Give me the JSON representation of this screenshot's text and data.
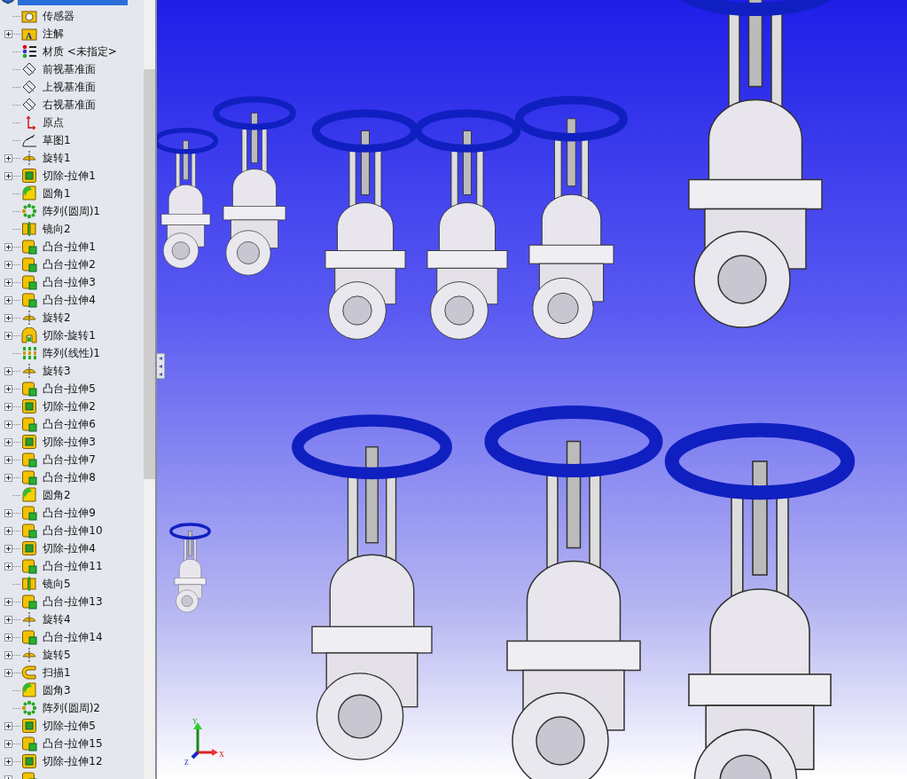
{
  "feature_tree": {
    "root": {
      "selected": true
    },
    "items": [
      {
        "label": "传感器",
        "kind": "sensor",
        "expandable": false
      },
      {
        "label": "注解",
        "kind": "annotation",
        "icon_text": "A",
        "expandable": true
      },
      {
        "label": "材质 <未指定>",
        "kind": "material",
        "expandable": false
      },
      {
        "label": "前视基准面",
        "kind": "plane",
        "expandable": false
      },
      {
        "label": "上视基准面",
        "kind": "plane",
        "expandable": false
      },
      {
        "label": "右视基准面",
        "kind": "plane",
        "expandable": false
      },
      {
        "label": "原点",
        "kind": "origin",
        "expandable": false
      },
      {
        "label": "草图1",
        "kind": "sketch",
        "expandable": false
      },
      {
        "label": "旋转1",
        "kind": "revolve",
        "expandable": true
      },
      {
        "label": "切除-拉伸1",
        "kind": "cut",
        "expandable": true
      },
      {
        "label": "圆角1",
        "kind": "fillet",
        "expandable": false
      },
      {
        "label": "阵列(圆周)1",
        "kind": "circular",
        "expandable": false
      },
      {
        "label": "镜向2",
        "kind": "mirror",
        "expandable": false
      },
      {
        "label": "凸台-拉伸1",
        "kind": "boss",
        "expandable": true
      },
      {
        "label": "凸台-拉伸2",
        "kind": "boss",
        "expandable": true
      },
      {
        "label": "凸台-拉伸3",
        "kind": "boss",
        "expandable": true
      },
      {
        "label": "凸台-拉伸4",
        "kind": "boss",
        "expandable": true
      },
      {
        "label": "旋转2",
        "kind": "revolve",
        "expandable": true
      },
      {
        "label": "切除-旋转1",
        "kind": "cutrevolve",
        "expandable": true
      },
      {
        "label": "阵列(线性)1",
        "kind": "linear",
        "expandable": false
      },
      {
        "label": "旋转3",
        "kind": "revolve",
        "expandable": true
      },
      {
        "label": "凸台-拉伸5",
        "kind": "boss",
        "expandable": true
      },
      {
        "label": "切除-拉伸2",
        "kind": "cut",
        "expandable": true
      },
      {
        "label": "凸台-拉伸6",
        "kind": "boss",
        "expandable": true
      },
      {
        "label": "切除-拉伸3",
        "kind": "cut",
        "expandable": true
      },
      {
        "label": "凸台-拉伸7",
        "kind": "boss",
        "expandable": true
      },
      {
        "label": "凸台-拉伸8",
        "kind": "boss",
        "expandable": true
      },
      {
        "label": "圆角2",
        "kind": "fillet",
        "expandable": false
      },
      {
        "label": "凸台-拉伸9",
        "kind": "boss",
        "expandable": true
      },
      {
        "label": "凸台-拉伸10",
        "kind": "boss",
        "expandable": true
      },
      {
        "label": "切除-拉伸4",
        "kind": "cut",
        "expandable": true
      },
      {
        "label": "凸台-拉伸11",
        "kind": "boss",
        "expandable": true
      },
      {
        "label": "镜向5",
        "kind": "mirror",
        "expandable": false
      },
      {
        "label": "凸台-拉伸13",
        "kind": "boss",
        "expandable": true
      },
      {
        "label": "旋转4",
        "kind": "revolve",
        "expandable": true
      },
      {
        "label": "凸台-拉伸14",
        "kind": "boss",
        "expandable": true
      },
      {
        "label": "旋转5",
        "kind": "revolve",
        "expandable": true
      },
      {
        "label": "扫描1",
        "kind": "sweep",
        "expandable": true
      },
      {
        "label": "圆角3",
        "kind": "fillet",
        "expandable": false
      },
      {
        "label": "阵列(圆周)2",
        "kind": "circular",
        "expandable": false
      },
      {
        "label": "切除-拉伸5",
        "kind": "cut",
        "expandable": true
      },
      {
        "label": "凸台-拉伸15",
        "kind": "boss",
        "expandable": true
      },
      {
        "label": "切除-拉伸12",
        "kind": "cut",
        "expandable": true
      },
      {
        "kind": "boss",
        "expandable": true
      }
    ]
  },
  "viewport": {
    "triad": {
      "x": "X",
      "y": "Y",
      "z": "Z"
    }
  }
}
